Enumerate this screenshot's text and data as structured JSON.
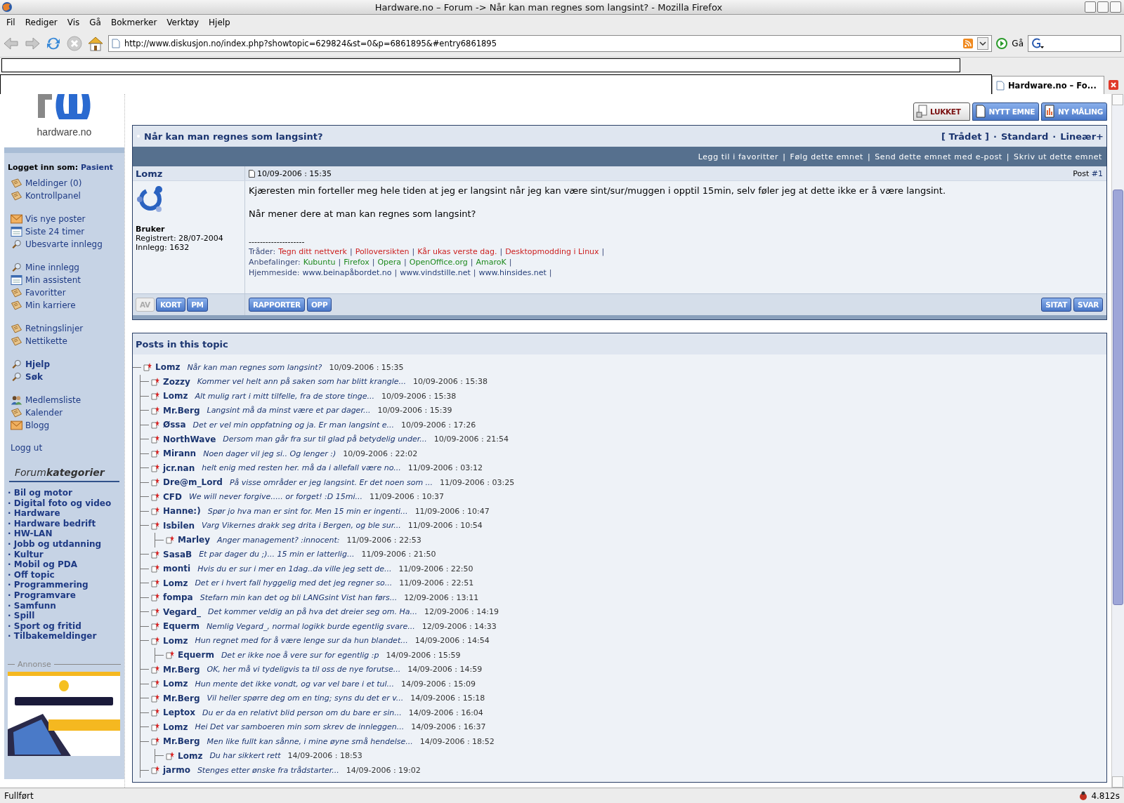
{
  "window": {
    "title": "Hardware.no – Forum -> Når kan man regnes som langsint? - Mozilla Firefox"
  },
  "menu": [
    "Fil",
    "Rediger",
    "Vis",
    "Gå",
    "Bokmerker",
    "Verktøy",
    "Hjelp"
  ],
  "navbar": {
    "url": "http://www.diskusjon.no/index.php?showtopic=629824&st=0&p=6861895&#entry6861895",
    "go_label": "Gå"
  },
  "tab": {
    "label": "Hardware.no – Fo...",
    "selected": true
  },
  "sidebar": {
    "logo_text": "hardware.no",
    "login_label": "Logget inn som:",
    "login_user": "Pasient",
    "groups": [
      [
        {
          "label": "Meldinger (0)",
          "kind": "note",
          "bold": false
        },
        {
          "label": "Kontrollpanel",
          "kind": "note",
          "bold": false
        }
      ],
      [
        {
          "label": "Vis nye poster",
          "kind": "mail",
          "bold": false
        },
        {
          "label": "Siste 24 timer",
          "kind": "calendar",
          "bold": false
        },
        {
          "label": "Ubesvarte innlegg",
          "kind": "search",
          "bold": false
        }
      ],
      [
        {
          "label": "Mine innlegg",
          "kind": "search",
          "bold": false
        },
        {
          "label": "Min assistent",
          "kind": "calendar",
          "bold": false
        },
        {
          "label": "Favoritter",
          "kind": "note",
          "bold": false
        },
        {
          "label": "Min karriere",
          "kind": "note",
          "bold": false
        }
      ],
      [
        {
          "label": "Retningslinjer",
          "kind": "note",
          "bold": false
        },
        {
          "label": "Nettikette",
          "kind": "note",
          "bold": false
        }
      ],
      [
        {
          "label": "Hjelp",
          "kind": "search",
          "bold": true
        },
        {
          "label": "Søk",
          "kind": "search",
          "bold": true
        }
      ],
      [
        {
          "label": "Medlemsliste",
          "kind": "members",
          "bold": false
        },
        {
          "label": "Kalender",
          "kind": "note",
          "bold": false
        },
        {
          "label": "Blogg",
          "kind": "mail",
          "bold": false
        }
      ],
      [
        {
          "label": "Logg ut",
          "kind": "plain",
          "bold": false
        }
      ]
    ],
    "categories_title": "Forum**kategorier**",
    "categories": [
      "Bil og motor",
      "Digital foto og video",
      "Hardware",
      "Hardware bedrift",
      "HW-LAN",
      "Jobb og utdanning",
      "Kultur",
      "Mobil og PDA",
      "Off topic",
      "Programmering",
      "Programvare",
      "Samfunn",
      "Spill",
      "Sport og fritid",
      "Tilbakemeldinger"
    ],
    "bullet": "·",
    "ad": {
      "label": "Annonse",
      "kind": "picture"
    }
  },
  "topic_buttons": [
    {
      "label": "LUKKET",
      "kind": "locked"
    },
    {
      "label": "NYTT EMNE",
      "kind": "new"
    },
    {
      "label": "NY MÅLING",
      "kind": "poll"
    }
  ],
  "topic": {
    "title": "Når kan man regnes som langsint?",
    "view_modes": [
      "[ Trådet ]",
      "Standard",
      "Lineær+"
    ],
    "mode_separator": "·",
    "actions": [
      "Legg til i favoritter",
      "Følg dette emnet",
      "Send dette emnet med e-post",
      "Skriv ut dette emnet"
    ],
    "action_separator": "|"
  },
  "post": {
    "author": "Lomz",
    "date": "10/09-2006 : 15:35",
    "number_label": "Post",
    "number": "#1",
    "user": {
      "group": "Bruker",
      "registered": "Registrert: 28/07-2004",
      "posts": "Innlegg: 1632"
    },
    "body": [
      "Kjæresten min forteller meg hele tiden at jeg er langsint når jeg kan være sint/sur/muggen i opptil 15min, selv føler jeg at dette ikke er å være langsint.",
      "Når mener dere at man kan regnes som langsint?"
    ],
    "signature_rule": "--------------------",
    "signature": [
      {
        "label": "Tråder:",
        "color": "#cc2020",
        "links": [
          "Tegn ditt nettverk",
          "Polloversikten",
          "Kår ukas verste dag.",
          "Desktopmodding i Linux"
        ]
      },
      {
        "label": "Anbefalinger:",
        "color": "#1e8a1e",
        "links": [
          "Kubuntu",
          "Firefox",
          "Opera",
          "OpenOffice.org",
          "AmaroK"
        ]
      },
      {
        "label": "Hjemmeside:",
        "color": "#27407a",
        "links": [
          "www.beinapåbordet.no",
          "www.vindstille.net",
          "www.hinsides.net"
        ]
      }
    ],
    "sig_separator": "|",
    "user_buttons": [
      {
        "label": "AV",
        "disabled": true
      },
      {
        "label": "KORT",
        "disabled": false
      },
      {
        "label": "PM",
        "disabled": false
      }
    ],
    "mid_buttons": [
      "RAPPORTER",
      "OPP"
    ],
    "reply_buttons": [
      "SITAT",
      "SVAR"
    ]
  },
  "posts_panel": {
    "title": "Posts in this topic",
    "tree": {
      "author": "Lomz",
      "snippet": "Når kan man regnes som langsint?",
      "date": "10/09-2006 : 15:35",
      "children": [
        {
          "author": "Zozzy",
          "snippet": "Kommer vel helt ann på saken som har blitt krangle...",
          "date": "10/09-2006 : 15:38"
        },
        {
          "author": "Lomz",
          "snippet": "Alt mulig rart i mitt tilfelle, fra de store tinge...",
          "date": "10/09-2006 : 15:38"
        },
        {
          "author": "Mr.Berg",
          "snippet": "Langsint må da minst være et par dager...",
          "date": "10/09-2006 : 15:39"
        },
        {
          "author": "Øssa",
          "snippet": "Det er vel min oppfatning og ja. Er man langsint e...",
          "date": "10/09-2006 : 17:26"
        },
        {
          "author": "NorthWave",
          "snippet": "Dersom man går fra sur til glad på betydelig under...",
          "date": "10/09-2006 : 21:54"
        },
        {
          "author": "Mirann",
          "snippet": "Noen dager vil jeg si.. Og lenger :)",
          "date": "10/09-2006 : 22:02"
        },
        {
          "author": "jcr.nan",
          "snippet": "helt enig med resten her. må da i allefall være no...",
          "date": "11/09-2006 : 03:12"
        },
        {
          "author": "Dre@m_Lord",
          "snippet": "På visse områder er jeg langsint. Er det noen som ...",
          "date": "11/09-2006 : 03:25"
        },
        {
          "author": "CFD",
          "snippet": "We will never forgive..... or forget! :D 15mi...",
          "date": "11/09-2006 : 10:37"
        },
        {
          "author": "Hanne:)",
          "snippet": "Spør jo hva man er sint for. Men 15 min er ingenti...",
          "date": "11/09-2006 : 10:47"
        },
        {
          "author": "Isbilen",
          "snippet": "Varg Vikernes drakk seg drita i Bergen, og ble sur...",
          "date": "11/09-2006 : 10:54",
          "children": [
            {
              "author": "Marley",
              "snippet": "Anger management? :innocent:",
              "date": "11/09-2006 : 22:53"
            }
          ]
        },
        {
          "author": "SasaB",
          "snippet": "Et par dager du ;)... 15 min er latterlig...",
          "date": "11/09-2006 : 21:50"
        },
        {
          "author": "monti",
          "snippet": "Hvis du er sur i mer en 1dag..da ville jeg sett de...",
          "date": "11/09-2006 : 22:50"
        },
        {
          "author": "Lomz",
          "snippet": "Det er i hvert fall hyggelig med det jeg regner so...",
          "date": "11/09-2006 : 22:51"
        },
        {
          "author": "fompa",
          "snippet": "Stefarn min kan det og bli LANGsint Vist han førs...",
          "date": "12/09-2006 : 13:11"
        },
        {
          "author": "Vegard_",
          "snippet": "Det kommer veldig an på hva det dreier seg om. Ha...",
          "date": "12/09-2006 : 14:19"
        },
        {
          "author": "Equerm",
          "snippet": "Nemlig Vegard_, normal logikk burde egentlig svare...",
          "date": "12/09-2006 : 14:33"
        },
        {
          "author": "Lomz",
          "snippet": "Hun regnet med for å være lenge sur da hun blandet...",
          "date": "14/09-2006 : 14:54",
          "children": [
            {
              "author": "Equerm",
              "snippet": "Det er ikke noe å vere sur for egentlig :p",
              "date": "14/09-2006 : 15:59"
            }
          ]
        },
        {
          "author": "Mr.Berg",
          "snippet": "OK, her må vi tydeligvis ta til oss de nye forutse...",
          "date": "14/09-2006 : 14:59"
        },
        {
          "author": "Lomz",
          "snippet": "Hun mente det ikke vondt, og var vel bare i et tul...",
          "date": "14/09-2006 : 15:09"
        },
        {
          "author": "Mr.Berg",
          "snippet": "Vil heller spørre deg om en ting; syns du det er v...",
          "date": "14/09-2006 : 15:18"
        },
        {
          "author": "Leptox",
          "snippet": "Du er da en relativt blid person om du bare er sin...",
          "date": "14/09-2006 : 16:04"
        },
        {
          "author": "Lomz",
          "snippet": "Hei Det var samboeren min som skrev de innleggen...",
          "date": "14/09-2006 : 16:37"
        },
        {
          "author": "Mr.Berg",
          "snippet": "Men like fullt kan sånne, i mine øyne små hendelse...",
          "date": "14/09-2006 : 18:52",
          "children": [
            {
              "author": "Lomz",
              "snippet": "Du har sikkert rett",
              "date": "14/09-2006 : 18:53"
            }
          ]
        },
        {
          "author": "jarmo",
          "snippet": "Stenges etter ønske fra trådstarter...",
          "date": "14/09-2006 : 19:02"
        }
      ]
    }
  },
  "status_bar": {
    "text": "Fullført",
    "timing": "4.812s"
  }
}
